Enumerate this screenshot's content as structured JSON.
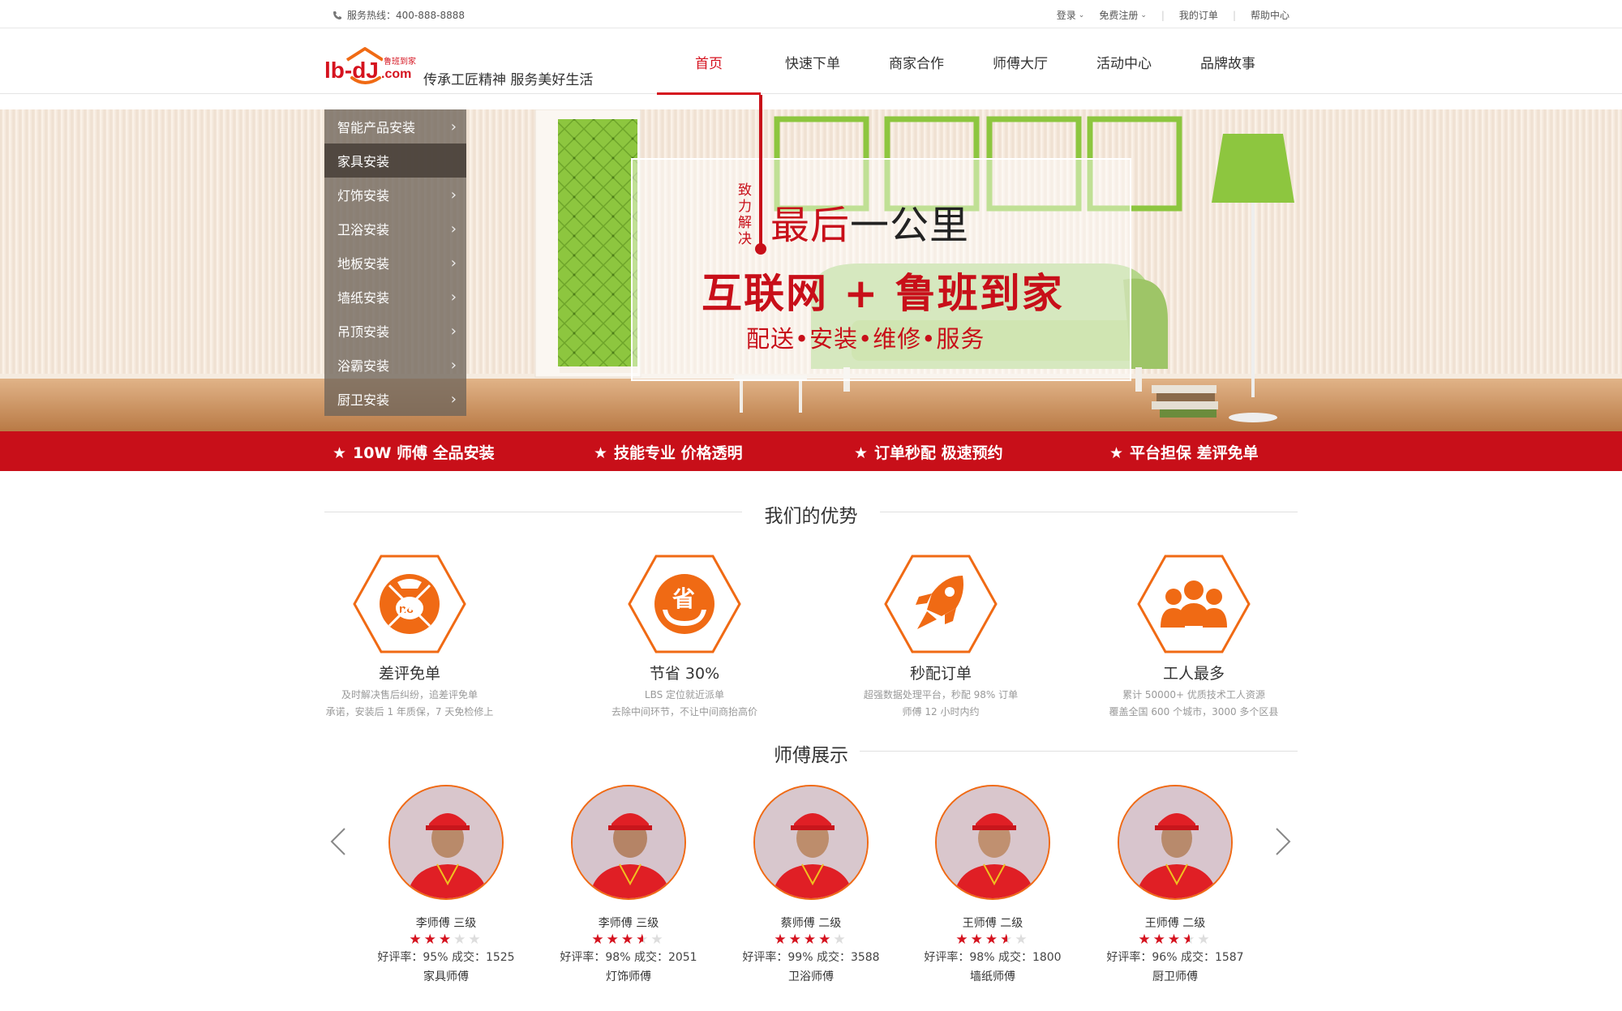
{
  "topbar": {
    "hotline": "服务热线：400-888-8888",
    "links": [
      "登录",
      "免费注册",
      "我的订单",
      "帮助中心"
    ]
  },
  "header": {
    "logo_text": "lb-dj.com",
    "logo_badge": "鲁班到家",
    "slogan": "传承工匠精神  服务美好生活",
    "nav": [
      {
        "label": "首页",
        "active": true
      },
      {
        "label": "快速下单",
        "active": false
      },
      {
        "label": "商家合作",
        "active": false
      },
      {
        "label": "师傅大厅",
        "active": false
      },
      {
        "label": "活动中心",
        "active": false
      },
      {
        "label": "品牌故事",
        "active": false
      }
    ]
  },
  "sidemenu": {
    "items": [
      {
        "label": "智能产品安装",
        "selected": false
      },
      {
        "label": "家具安装",
        "selected": true
      },
      {
        "label": "灯饰安装",
        "selected": false
      },
      {
        "label": "卫浴安装",
        "selected": false
      },
      {
        "label": "地板安装",
        "selected": false
      },
      {
        "label": "墙纸安装",
        "selected": false
      },
      {
        "label": "吊顶安装",
        "selected": false
      },
      {
        "label": "浴霸安装",
        "selected": false
      },
      {
        "label": "厨卫安装",
        "selected": false
      }
    ]
  },
  "banner": {
    "zhili": "致力解决",
    "last_mile_red": "最后",
    "last_mile_rest": "一公里",
    "headline": "互联网 + 鲁班到家",
    "services": "配送•安装•维修•服务"
  },
  "strip": [
    "10W 师傅  全品安装",
    "技能专业  价格透明",
    "订单秒配  极速预约",
    "平台担保  差评免单"
  ],
  "advantages": {
    "title": "我们的优势",
    "items": [
      {
        "title": "差评免单",
        "icon": "no-bad-review-icon",
        "lines": [
          "及时解决售后纠纷，追差评免单",
          "承诺，安装后 1 年质保，7 天免检修上"
        ]
      },
      {
        "title": "节省 30%",
        "icon": "save-money-icon",
        "lines": [
          "LBS 定位就近派单",
          "去除中间环节，不让中间商抬高价"
        ]
      },
      {
        "title": "秒配订单",
        "icon": "rocket-icon",
        "lines": [
          "超强数据处理平台，秒配 98% 订单",
          "师傅 12 小时内约"
        ]
      },
      {
        "title": "工人最多",
        "icon": "workers-icon",
        "lines": [
          "累计 50000+ 优质技术工人资源",
          "覆盖全国 600 个城市，3000 多个区县"
        ]
      }
    ]
  },
  "masters": {
    "title": "师傅展示",
    "items": [
      {
        "name": "李师傅  三级",
        "rating": 3,
        "stat": "好评率：95%   成交：1525",
        "role": "家具师傅"
      },
      {
        "name": "李师傅  三级",
        "rating": 3.5,
        "stat": "好评率：98%   成交：2051",
        "role": "灯饰师傅"
      },
      {
        "name": "蔡师傅  二级",
        "rating": 4,
        "stat": "好评率：99%   成交：3588",
        "role": "卫浴师傅"
      },
      {
        "name": "王师傅  二级",
        "rating": 3.5,
        "stat": "好评率：98%   成交：1800",
        "role": "墙纸师傅"
      },
      {
        "name": "王师傅  二级",
        "rating": 3.5,
        "stat": "好评率：96%   成交：1587",
        "role": "厨卫师傅"
      }
    ]
  },
  "colors": {
    "brand_red": "#c80f19",
    "accent_orange": "#f06a14"
  }
}
